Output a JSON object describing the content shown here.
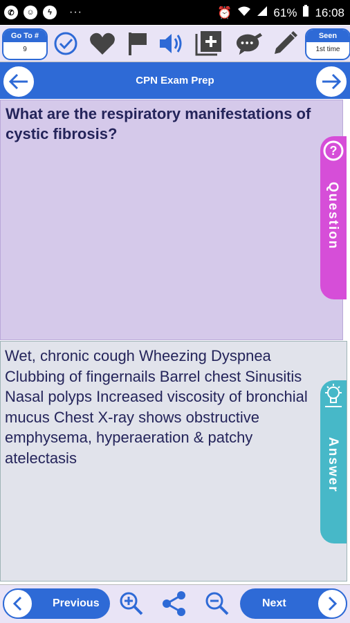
{
  "status_bar": {
    "battery": "61%",
    "time": "16:08",
    "left_icons": [
      "whatsapp-icon",
      "smiley-icon",
      "messenger-icon"
    ],
    "more": "···"
  },
  "toolbar": {
    "goto_label": "Go To #",
    "goto_value": "9",
    "seen_label": "Seen",
    "seen_value": "1st time",
    "icons": [
      "check-circle-icon",
      "heart-icon",
      "flag-icon",
      "speaker-icon",
      "add-card-icon",
      "comment-edit-icon",
      "pencil-icon"
    ]
  },
  "header": {
    "title": "CPN Exam Prep"
  },
  "question": {
    "text": "What are the respiratory manifestations of cystic fibrosis?",
    "tab_label": "Question"
  },
  "answer": {
    "text": "Wet, chronic cough Wheezing Dyspnea Clubbing of fingernails Barrel chest Sinusitis Nasal polyps Increased viscosity of bronchial mucus Chest X-ray shows obstructive emphysema, hyperaeration & patchy atelectasis",
    "tab_label": "Answer"
  },
  "bottom_bar": {
    "previous_label": "Previous",
    "next_label": "Next"
  },
  "colors": {
    "accent": "#2e6ad6",
    "question_bg": "#d5c9ea",
    "question_tab": "#d64ed8",
    "answer_bg": "#e1e3eb",
    "answer_tab": "#47b8c8",
    "text": "#24245a"
  }
}
